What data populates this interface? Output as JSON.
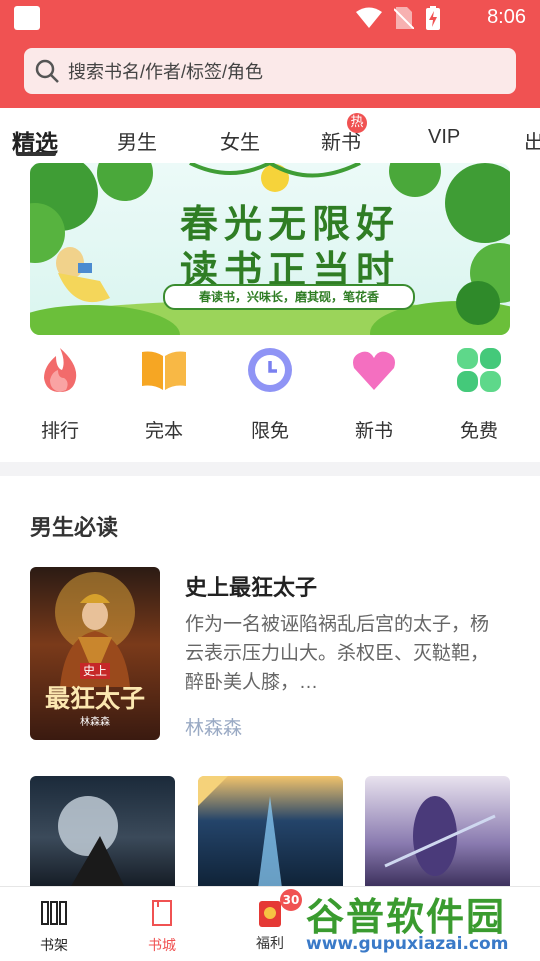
{
  "status_bar": {
    "time": "8:06"
  },
  "search": {
    "placeholder": "搜索书名/作者/标签/角色"
  },
  "tabs": [
    {
      "label": "精选",
      "active": true
    },
    {
      "label": "男生"
    },
    {
      "label": "女生"
    },
    {
      "label": "新书",
      "badge": "热"
    },
    {
      "label": "VIP"
    },
    {
      "label": "出"
    }
  ],
  "banner": {
    "line1": "春光无限好",
    "line2": "读书正当时",
    "subtitle": "春读书，兴味长，磨其砚，笔花香"
  },
  "categories": [
    {
      "label": "排行",
      "icon": "flame-icon"
    },
    {
      "label": "完本",
      "icon": "open-book-icon"
    },
    {
      "label": "限免",
      "icon": "clock-icon"
    },
    {
      "label": "新书",
      "icon": "heart-icon"
    },
    {
      "label": "免费",
      "icon": "clover-icon"
    }
  ],
  "section": {
    "title": "男生必读"
  },
  "featured_book": {
    "title": "史上最狂太子",
    "cover_text": "最狂太子",
    "cover_small": "史上",
    "cover_author": "林森森",
    "description": "作为一名被诬陷祸乱后宫的太子，杨云表示压力山大。杀权臣、灭鞑靼，醉卧美人膝，…",
    "author": "林森森"
  },
  "bottom_nav": [
    {
      "label": "书架",
      "icon": "bookshelf-icon"
    },
    {
      "label": "书城",
      "icon": "book-city-icon",
      "active": true
    },
    {
      "label": "福利",
      "icon": "red-envelope-icon",
      "badge": "30"
    }
  ],
  "watermark": {
    "main": "谷普软件园",
    "url": "www.gupuxiazai.com"
  },
  "colors": {
    "brand": "#f05252",
    "banner_green": "#2f7d24",
    "author": "#9aaac4"
  }
}
